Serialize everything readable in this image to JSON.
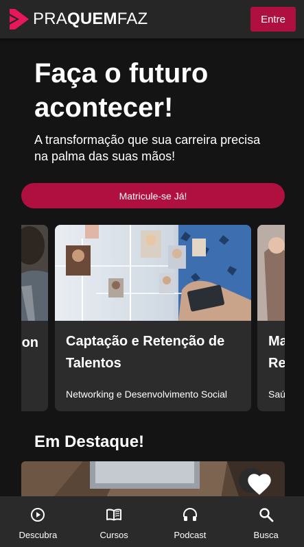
{
  "colors": {
    "background": "#141414",
    "header": "#262626",
    "accent": "#b0103f",
    "card": "#2c2c2c",
    "nav": "#2a2a2a"
  },
  "header": {
    "logo_icon": "praquemfaz-logo-icon",
    "logo_light": "PRA",
    "logo_bold": "QUEM",
    "logo_light2": "FAZ",
    "login_label": "Entre"
  },
  "hero": {
    "title": "Faça o futuro acontecer!",
    "subtitle": "A transformação que sua carreira precisa na palma das suas mãos!",
    "cta_label": "Matricule-se Já!"
  },
  "courses": [
    {
      "title": "on",
      "subtitle": ""
    },
    {
      "title": "Captação e Retenção de Talentos",
      "subtitle": "Networking e Desenvolvimento Social"
    },
    {
      "title": "Ma Re",
      "subtitle": "Saú"
    }
  ],
  "featured": {
    "title": "Em Destaque!",
    "favorite_icon": "heart-icon"
  },
  "bottom_nav": [
    {
      "label": "Descubra",
      "icon": "play-circle-icon"
    },
    {
      "label": "Cursos",
      "icon": "book-open-icon"
    },
    {
      "label": "Podcast",
      "icon": "headphones-icon"
    },
    {
      "label": "Busca",
      "icon": "search-icon"
    }
  ]
}
